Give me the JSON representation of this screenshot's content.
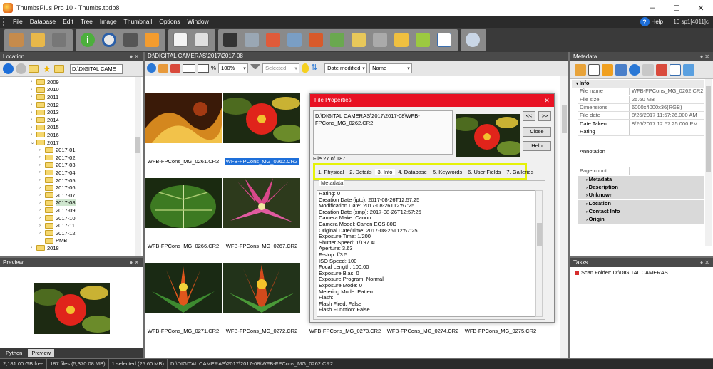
{
  "window": {
    "title": "ThumbsPlus Pro 10 - Thumbs.tpdb8",
    "min": "–",
    "max": "☐",
    "close": "✕"
  },
  "menu": {
    "items": [
      "File",
      "Database",
      "Edit",
      "Tree",
      "Image",
      "Thumbnail",
      "Options",
      "Window"
    ],
    "help": "Help",
    "version": "10 sp1[4011]c"
  },
  "location": {
    "header": "Location",
    "pin": "♦ ✕",
    "path": "D:\\DIGITAL CAME",
    "tree": [
      {
        "label": "2009",
        "x": 55,
        "exp": "›"
      },
      {
        "label": "2010",
        "x": 55,
        "exp": "›"
      },
      {
        "label": "2011",
        "x": 55,
        "exp": "›"
      },
      {
        "label": "2012",
        "x": 55,
        "exp": "›"
      },
      {
        "label": "2013",
        "x": 55,
        "exp": "›"
      },
      {
        "label": "2014",
        "x": 55,
        "exp": "›"
      },
      {
        "label": "2015",
        "x": 55,
        "exp": "›"
      },
      {
        "label": "2016",
        "x": 55,
        "exp": "›"
      },
      {
        "label": "2017",
        "x": 55,
        "exp": "⌄"
      },
      {
        "label": "2017-01",
        "x": 67,
        "exp": "›"
      },
      {
        "label": "2017-02",
        "x": 67,
        "exp": "›"
      },
      {
        "label": "2017-03",
        "x": 67,
        "exp": "›"
      },
      {
        "label": "2017-04",
        "x": 67,
        "exp": "›"
      },
      {
        "label": "2017-05",
        "x": 67,
        "exp": "›"
      },
      {
        "label": "2017-06",
        "x": 67,
        "exp": "›"
      },
      {
        "label": "2017-07",
        "x": 67,
        "exp": "›"
      },
      {
        "label": "2017-08",
        "x": 67,
        "exp": "›",
        "selected": true
      },
      {
        "label": "2017-09",
        "x": 67,
        "exp": "›"
      },
      {
        "label": "2017-10",
        "x": 67,
        "exp": "›"
      },
      {
        "label": "2017-11",
        "x": 67,
        "exp": "›"
      },
      {
        "label": "2017-12",
        "x": 67,
        "exp": "›"
      },
      {
        "label": "PMB",
        "x": 67,
        "exp": ""
      },
      {
        "label": "2018",
        "x": 55,
        "exp": "›"
      }
    ]
  },
  "preview": {
    "header": "Preview",
    "tabs": [
      "Python",
      "Preview"
    ]
  },
  "center": {
    "path": "D:\\DIGITAL CAMERAS\\2017\\2017-08",
    "zoom_pct": "%",
    "zoom": "100%",
    "filter": "Selected",
    "sort1": "Date modified",
    "sort2": "Name",
    "thumbs": [
      {
        "caption": "WFB-FPCons_MG_0261.CR2",
        "kind": "abstract"
      },
      {
        "caption": "WFB-FPCons_MG_0262.CR2",
        "kind": "red",
        "selected": true
      },
      {
        "caption": "WFB-FPCons_MG_0266.CR2",
        "kind": "leaf"
      },
      {
        "caption": "WFB-FPCons_MG_0267.CR2",
        "kind": "pink"
      },
      {
        "caption": "WFB-FPCons_MG_0271.CR2",
        "kind": "brom"
      },
      {
        "caption": "WFB-FPCons_MG_0272.CR2",
        "kind": "brom2"
      },
      {
        "caption": "WFB-FPCons_MG_0273.CR2",
        "kind": "none"
      },
      {
        "caption": "WFB-FPCons_MG_0274.CR2",
        "kind": "none"
      },
      {
        "caption": "WFB-FPCons_MG_0275.CR2",
        "kind": "none"
      }
    ]
  },
  "metadata": {
    "header": "Metadata",
    "info_label": "Info",
    "rows": [
      {
        "k": "File name",
        "v": "WFB-FPCons_MG_0262.CR2"
      },
      {
        "k": "File size",
        "v": "25.60 MB"
      },
      {
        "k": "Dimensions",
        "v": "6000x4000x36(RGB)"
      },
      {
        "k": "File date",
        "v": "8/26/2017 11:57:26.000 AM"
      },
      {
        "k": "Date Taken",
        "v": "8/26/2017 12:57:25.000 PM",
        "dark": true
      },
      {
        "k": "Rating",
        "v": "",
        "dark": true
      },
      {
        "k": "Annotation",
        "v": "",
        "dark": true
      },
      {
        "k": "Page count",
        "v": ""
      }
    ],
    "meta_label": "Metadata",
    "subs": [
      "Description",
      "Unknown",
      "Location",
      "Contact Info",
      "Origin"
    ]
  },
  "tasks": {
    "header": "Tasks",
    "item": "Scan Folder: D:\\DIGITAL CAMERAS"
  },
  "status": {
    "free": "2,181.00 GB free",
    "files": "187 files (5,370.08 MB)",
    "selected": "1 selected (25.60 MB)",
    "path": "D:\\DIGITAL CAMERAS\\2017\\2017-08\\WFB-FPCons_MG_0262.CR2"
  },
  "dialog": {
    "title": "File Properties",
    "path": "D:\\DIGITAL CAMERAS\\2017\\2017-08\\WFB-FPCons_MG_0262.CR2",
    "count": "File 27 of 187",
    "prev": "<<",
    "next": ">>",
    "close_btn": "Close",
    "help_btn": "Help",
    "tabs": [
      "1. Physical",
      "2. Details",
      "3. Info",
      "4. Database",
      "5. Keywords",
      "6. User Fields",
      "7. Galleries"
    ],
    "group_label": "Metadata",
    "lines": [
      "Rating: 0",
      "Creation Date (iptc): 2017-08-26T12:57:25",
      "Modification Date: 2017-08-26T12:57:25",
      "Creation Date (xmp): 2017-08-26T12:57:25",
      "Camera Make: Canon",
      "Camera Model: Canon EOS 80D",
      "Original Date/Time: 2017-08-26T12:57:25",
      "Exposure Time: 1/200",
      "Shutter Speed: 1/197.40",
      "Aperture: 3.63",
      "F-stop: f/3.5",
      "ISO Speed: 100",
      "Focal Length: 100.00",
      "Exposure Bias: 0",
      "Exposure Program: Normal",
      "Exposure Mode: 0",
      "Metering Mode: Pattern",
      "Flash:",
      "Flash Fired: False",
      "Flash Function: False"
    ]
  }
}
